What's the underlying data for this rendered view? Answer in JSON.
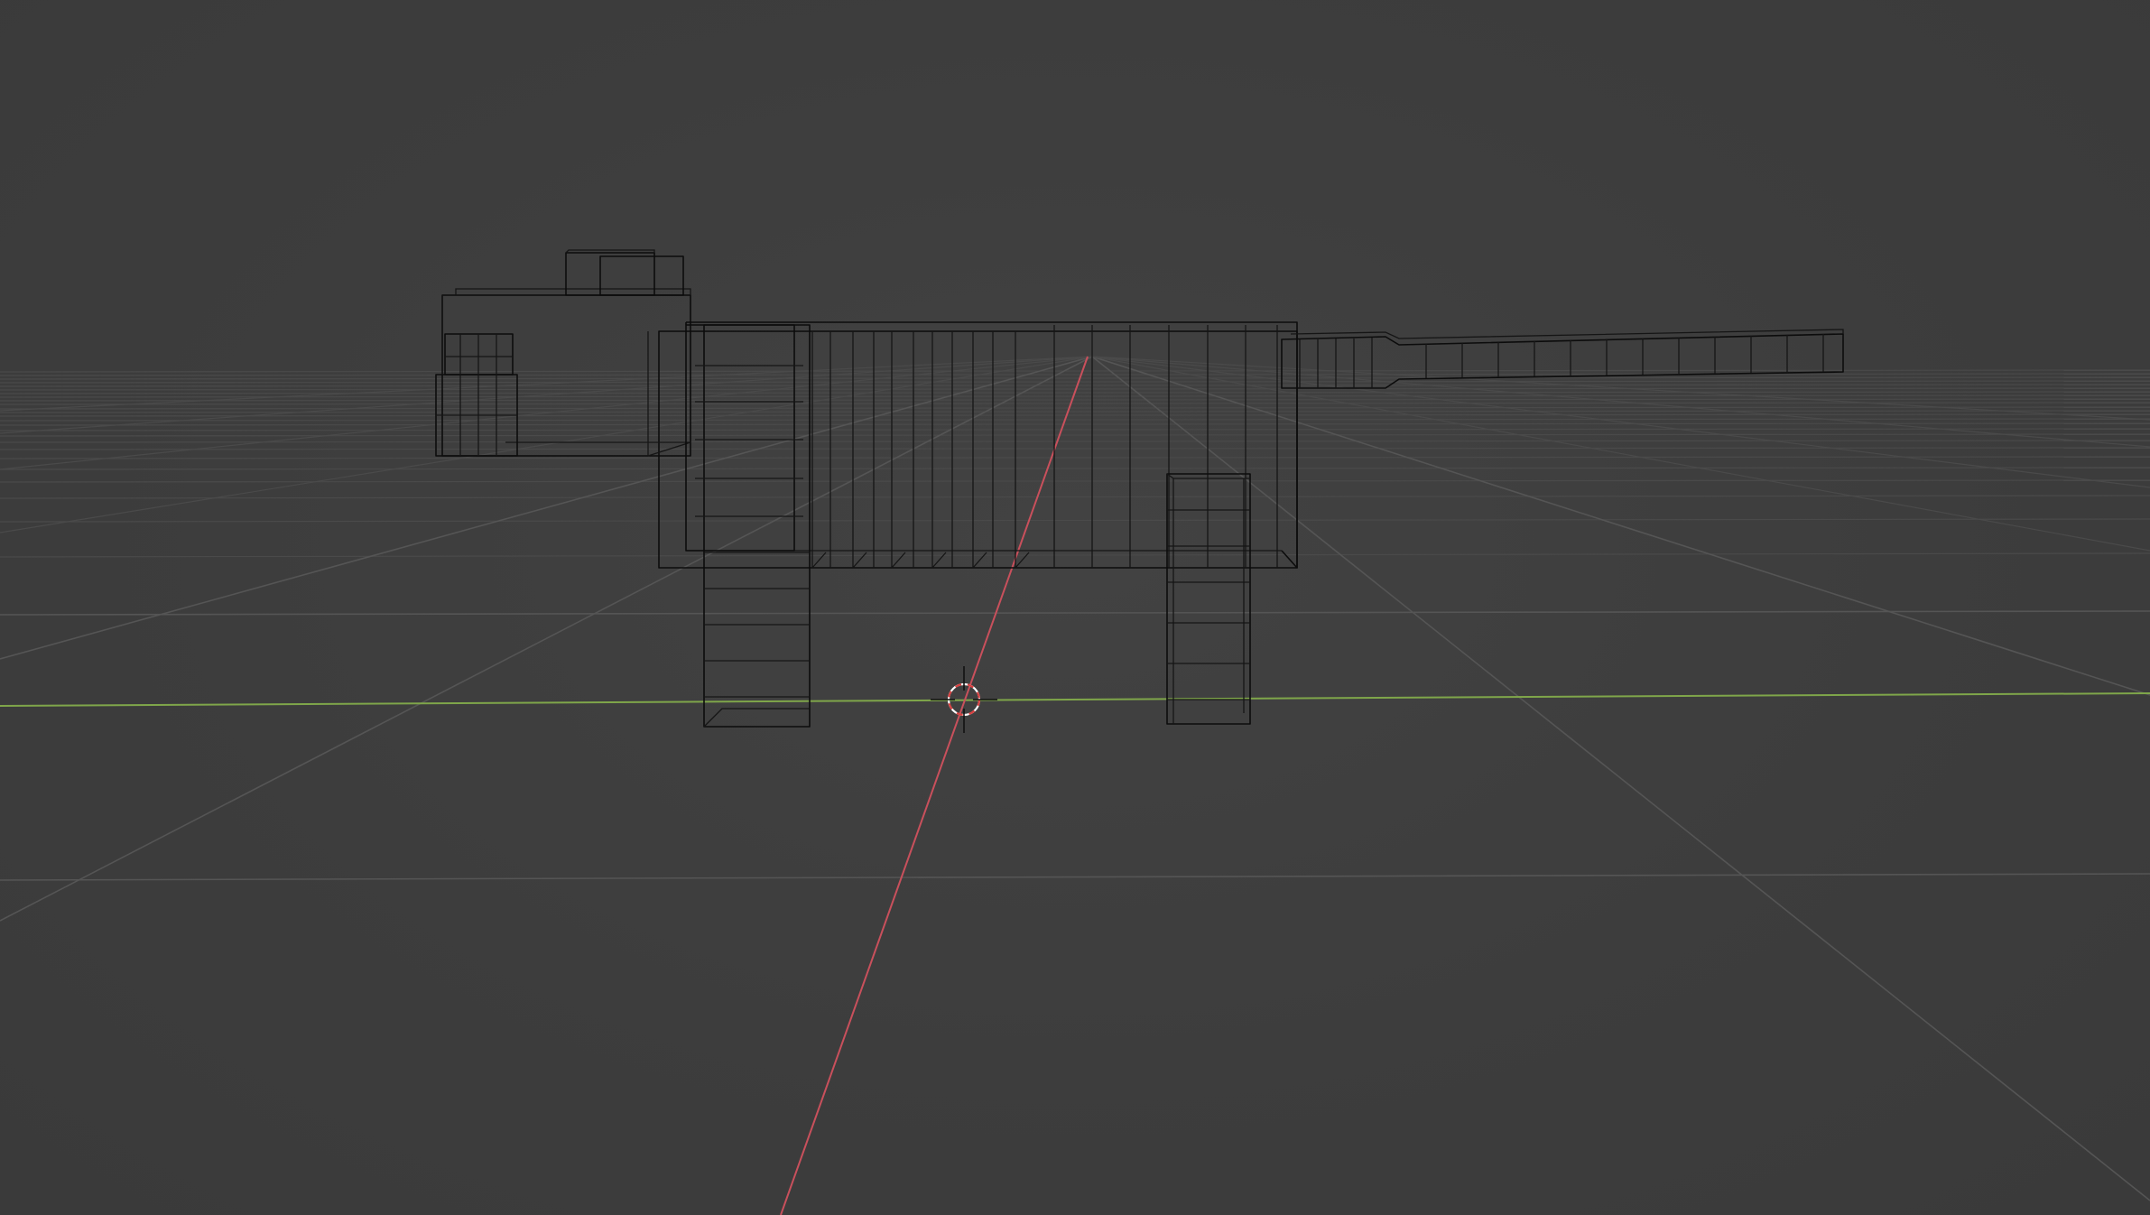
{
  "viewport": {
    "mode": "wireframe",
    "background": "#3d3d3d",
    "grid_color": "#555555",
    "x_axis_color": "#c9505c",
    "y_axis_color": "#7fa64a",
    "wire_color": "#0c0c0c"
  },
  "scene": {
    "object": "blocky cat mesh",
    "parts": [
      "head",
      "ears",
      "snout",
      "body",
      "front-leg",
      "back-leg",
      "tail"
    ]
  },
  "cursor": {
    "icon": "3d-cursor-icon",
    "colors": [
      "#d94040",
      "#ffffff"
    ]
  }
}
